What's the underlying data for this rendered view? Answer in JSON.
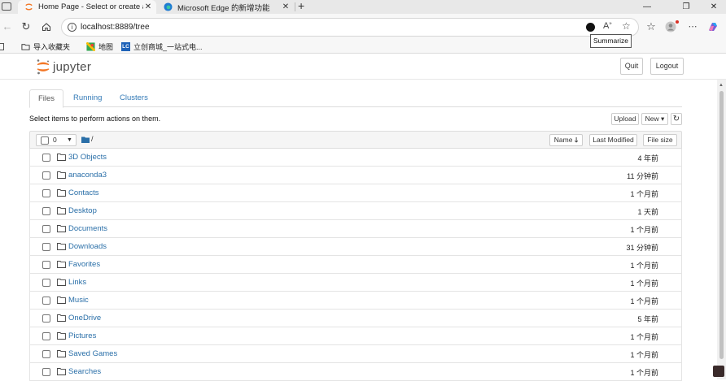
{
  "browser": {
    "tabs": [
      {
        "title": "Home Page - Select or create a n",
        "active": true
      },
      {
        "title": "Microsoft Edge 的新增功能",
        "active": false
      }
    ],
    "new_tab": "+",
    "url": "localhost:8889/tree",
    "tooltip": "Summarize",
    "bookmarks": [
      {
        "label": "导入收藏夹"
      },
      {
        "label": "地图"
      },
      {
        "label": "立创商城_一站式电..."
      }
    ],
    "window_controls": {
      "minimize": "—",
      "maximize": "❐",
      "close": "✕"
    }
  },
  "jupyter": {
    "logo_text": "jupyter",
    "quit_label": "Quit",
    "logout_label": "Logout",
    "tabs": [
      {
        "label": "Files",
        "active": true
      },
      {
        "label": "Running",
        "active": false
      },
      {
        "label": "Clusters",
        "active": false
      }
    ],
    "instructions": "Select items to perform actions on them.",
    "upload_label": "Upload",
    "new_label": "New ▾",
    "refresh_icon": "↻",
    "selected_count": "0",
    "path": "/",
    "sort_buttons": {
      "name": "Name",
      "last_modified": "Last Modified",
      "file_size": "File size"
    },
    "files": [
      {
        "name": "3D Objects",
        "modified": "4 年前"
      },
      {
        "name": "anaconda3",
        "modified": "11 分钟前"
      },
      {
        "name": "Contacts",
        "modified": "1 个月前"
      },
      {
        "name": "Desktop",
        "modified": "1 天前"
      },
      {
        "name": "Documents",
        "modified": "1 个月前"
      },
      {
        "name": "Downloads",
        "modified": "31 分钟前"
      },
      {
        "name": "Favorites",
        "modified": "1 个月前"
      },
      {
        "name": "Links",
        "modified": "1 个月前"
      },
      {
        "name": "Music",
        "modified": "1 个月前"
      },
      {
        "name": "OneDrive",
        "modified": "5 年前"
      },
      {
        "name": "Pictures",
        "modified": "1 个月前"
      },
      {
        "name": "Saved Games",
        "modified": "1 个月前"
      },
      {
        "name": "Searches",
        "modified": "1 个月前"
      }
    ]
  },
  "colors": {
    "link": "#2a6fa8",
    "jupyter_orange": "#f37726",
    "folder_dark": "#2a6fa8"
  }
}
